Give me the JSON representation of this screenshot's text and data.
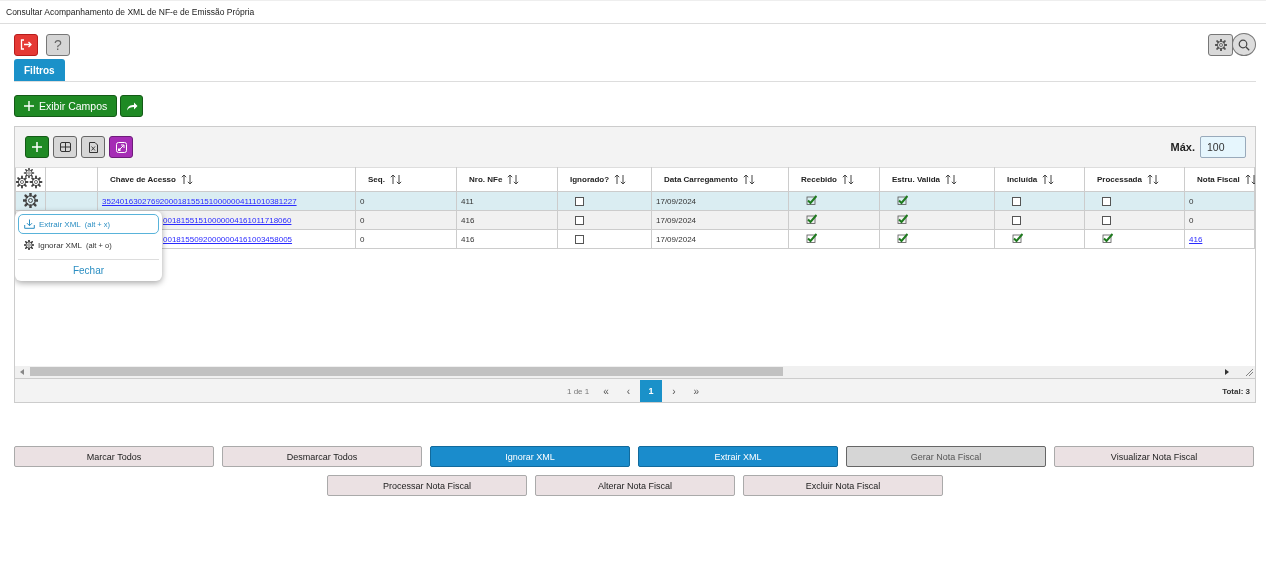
{
  "window": {
    "title": "Consultar Acompanhamento de XML de NF-e de Emissão Própria"
  },
  "toolbar": {
    "help_label": "?"
  },
  "tabs": [
    {
      "label": "Filtros",
      "selected": true
    }
  ],
  "field_button": {
    "label": "Exibir Campos"
  },
  "grid": {
    "max_label": "Máx.",
    "max_value": "100",
    "columns": [
      "Chave de Acesso",
      "Seq.",
      "Nro. NFe",
      "Ignorado?",
      "Data Carregamento",
      "Recebido",
      "Estru. Valida",
      "Incluída",
      "Processada",
      "Nota Fiscal"
    ],
    "rows": [
      {
        "selected": true,
        "chave": "35240163027692000181551510000004111010381227",
        "seq": "0",
        "nro": "411",
        "ignorado": false,
        "data": "17/09/2024",
        "recebido": true,
        "estru_valida": true,
        "incluida": false,
        "processada": false,
        "nota_fiscal": "0",
        "nota_fiscal_link": false
      },
      {
        "selected": false,
        "chave": "00181551510000004161011718060",
        "seq": "0",
        "nro": "416",
        "ignorado": false,
        "data": "17/09/2024",
        "recebido": true,
        "estru_valida": true,
        "incluida": false,
        "processada": false,
        "nota_fiscal": "0",
        "nota_fiscal_link": false
      },
      {
        "selected": false,
        "chave": "00181550920000004161003458005",
        "seq": "0",
        "nro": "416",
        "ignorado": false,
        "data": "17/09/2024",
        "recebido": true,
        "estru_valida": true,
        "incluida": true,
        "processada": true,
        "nota_fiscal": "416",
        "nota_fiscal_link": true
      }
    ],
    "row_menu": {
      "open": true,
      "items": [
        {
          "kind": "extract",
          "label": "Extrair XML",
          "shortcut": "(alt + x)",
          "selected": true
        },
        {
          "kind": "ignore",
          "label": "Ignorar XML",
          "shortcut": "(alt + o)",
          "selected": false
        }
      ],
      "close_label": "Fechar"
    },
    "pagination": {
      "summary": "1 de 1",
      "first": "«",
      "prev": "‹",
      "pages": [
        {
          "label": "1",
          "selected": true
        }
      ],
      "next": "›",
      "last": "»",
      "total": "Total: 3"
    }
  },
  "buttons": [
    {
      "label": "Marcar Todos",
      "kind": "plain",
      "disabled": false
    },
    {
      "label": "Desmarcar Todos",
      "kind": "plain",
      "disabled": false
    },
    {
      "label": "Ignorar XML",
      "kind": "primary",
      "disabled": false
    },
    {
      "label": "Extrair XML",
      "kind": "primary",
      "disabled": false
    },
    {
      "label": "Gerar Nota Fiscal",
      "kind": "plain",
      "disabled": true
    },
    {
      "label": "Visualizar Nota Fiscal",
      "kind": "plain",
      "disabled": false
    },
    {
      "label": "Processar Nota Fiscal",
      "kind": "plain",
      "disabled": false
    },
    {
      "label": "Alterar Nota Fiscal",
      "kind": "plain",
      "disabled": false
    },
    {
      "label": "Excluir Nota Fiscal",
      "kind": "plain",
      "disabled": false
    }
  ]
}
